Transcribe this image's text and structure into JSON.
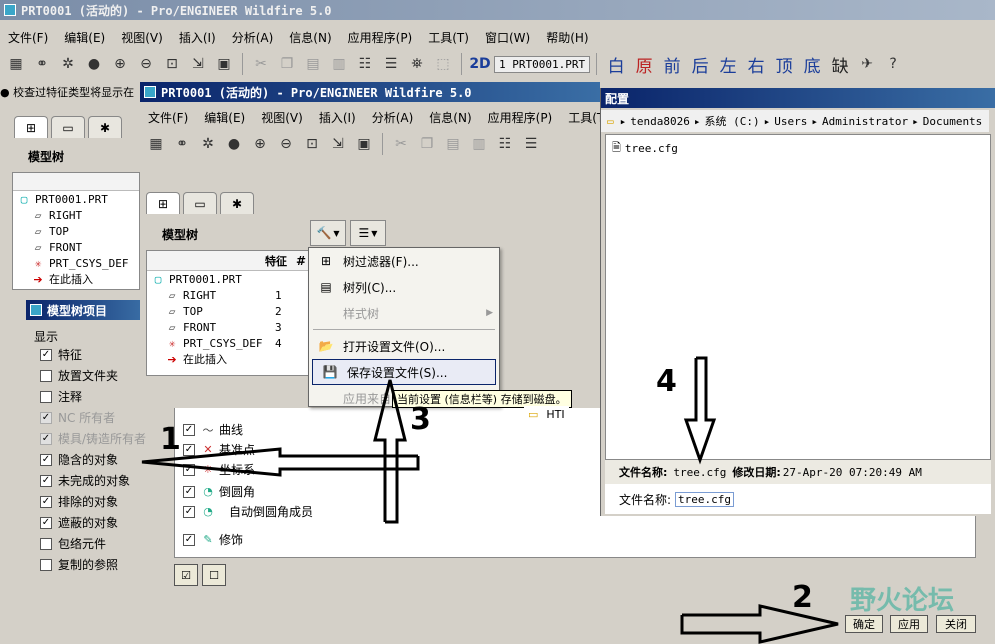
{
  "bg_window": {
    "title": "PRT0001 (活动的) - Pro/ENGINEER Wildfire 5.0",
    "menu": [
      "文件(F)",
      "编辑(E)",
      "视图(V)",
      "插入(I)",
      "分析(A)",
      "信息(N)",
      "应用程序(P)",
      "工具(T)",
      "窗口(W)",
      "帮助(H)"
    ],
    "mode_2d": "2D",
    "model_selector": "1 PRT0001.PRT",
    "cn_tools": [
      "白",
      "原",
      "前",
      "后",
      "左",
      "右",
      "顶",
      "底",
      "缺"
    ],
    "status_text": "● 校查过特征类型将显示在",
    "model_tree_label": "模型树",
    "tree": [
      "PRT0001.PRT",
      "RIGHT",
      "TOP",
      "FRONT",
      "PRT_CSYS_DEF",
      "在此插入"
    ]
  },
  "fg_window": {
    "title": "PRT0001 (活动的) - Pro/ENGINEER Wildfire 5.0",
    "menu": [
      "文件(F)",
      "编辑(E)",
      "视图(V)",
      "插入(I)",
      "分析(A)",
      "信息(N)",
      "应用程序(P)",
      "工具(T)"
    ],
    "model_tree_label": "模型树",
    "col_feature": "特征",
    "col_hash": "#",
    "tree": [
      {
        "name": "PRT0001.PRT",
        "num": ""
      },
      {
        "name": "RIGHT",
        "num": "1"
      },
      {
        "name": "TOP",
        "num": "2"
      },
      {
        "name": "FRONT",
        "num": "3"
      },
      {
        "name": "PRT_CSYS_DEF",
        "num": "4"
      },
      {
        "name": "在此插入",
        "num": ""
      }
    ]
  },
  "settings_menu": {
    "items": [
      "树过滤器(F)...",
      "树列(C)...",
      "样式树",
      "打开设置文件(O)...",
      "保存设置文件(S)...",
      "应用来自"
    ],
    "tooltip": "当前设置 (信息栏等) 存储到磁盘。"
  },
  "model_tree_items": {
    "title": "模型树项目",
    "display_label": "显示",
    "options": [
      {
        "label": "特征",
        "checked": true,
        "disabled": false
      },
      {
        "label": "放置文件夹",
        "checked": false,
        "disabled": false
      },
      {
        "label": "注释",
        "checked": false,
        "disabled": false
      },
      {
        "label": "NC 所有者",
        "checked": true,
        "disabled": true
      },
      {
        "label": "模具/铸造所有者",
        "checked": true,
        "disabled": true
      },
      {
        "label": "隐含的对象",
        "checked": true,
        "disabled": false
      },
      {
        "label": "未完成的对象",
        "checked": true,
        "disabled": false
      },
      {
        "label": "排除的对象",
        "checked": true,
        "disabled": false
      },
      {
        "label": "遮蔽的对象",
        "checked": true,
        "disabled": false
      },
      {
        "label": "包络元件",
        "checked": false,
        "disabled": false
      },
      {
        "label": "复制的参照",
        "checked": false,
        "disabled": false
      }
    ],
    "feature_types": [
      {
        "label": "曲线",
        "checked": true
      },
      {
        "label": "基准点",
        "checked": true
      },
      {
        "label": "坐标系",
        "checked": true
      },
      {
        "label": "倒圆角",
        "checked": true
      },
      {
        "label": "自动倒圆角成员",
        "checked": true
      },
      {
        "label": "修饰",
        "checked": true
      }
    ],
    "buttons": {
      "ok": "确定",
      "apply": "应用",
      "close": "关闭"
    }
  },
  "config_dialog": {
    "title": "配置",
    "path": [
      "tenda8026",
      "系统 (C:)",
      "Users",
      "Administrator",
      "Documents"
    ],
    "files": [
      "tree.cfg"
    ],
    "folder_hti": "HTI",
    "info_name_label": "文件名称:",
    "info_name": "tree.cfg",
    "info_date_label": "修改日期:",
    "info_date": "27-Apr-20 07:20:49 AM",
    "filename_label": "文件名称:",
    "filename_value": "tree.cfg"
  },
  "annotations": [
    "1",
    "2",
    "3",
    "4"
  ],
  "watermark": "野火论坛",
  "colors": {
    "title_active": "#0a246a",
    "title_inactive": "#7a8da8",
    "panel": "#d4d0c8"
  }
}
